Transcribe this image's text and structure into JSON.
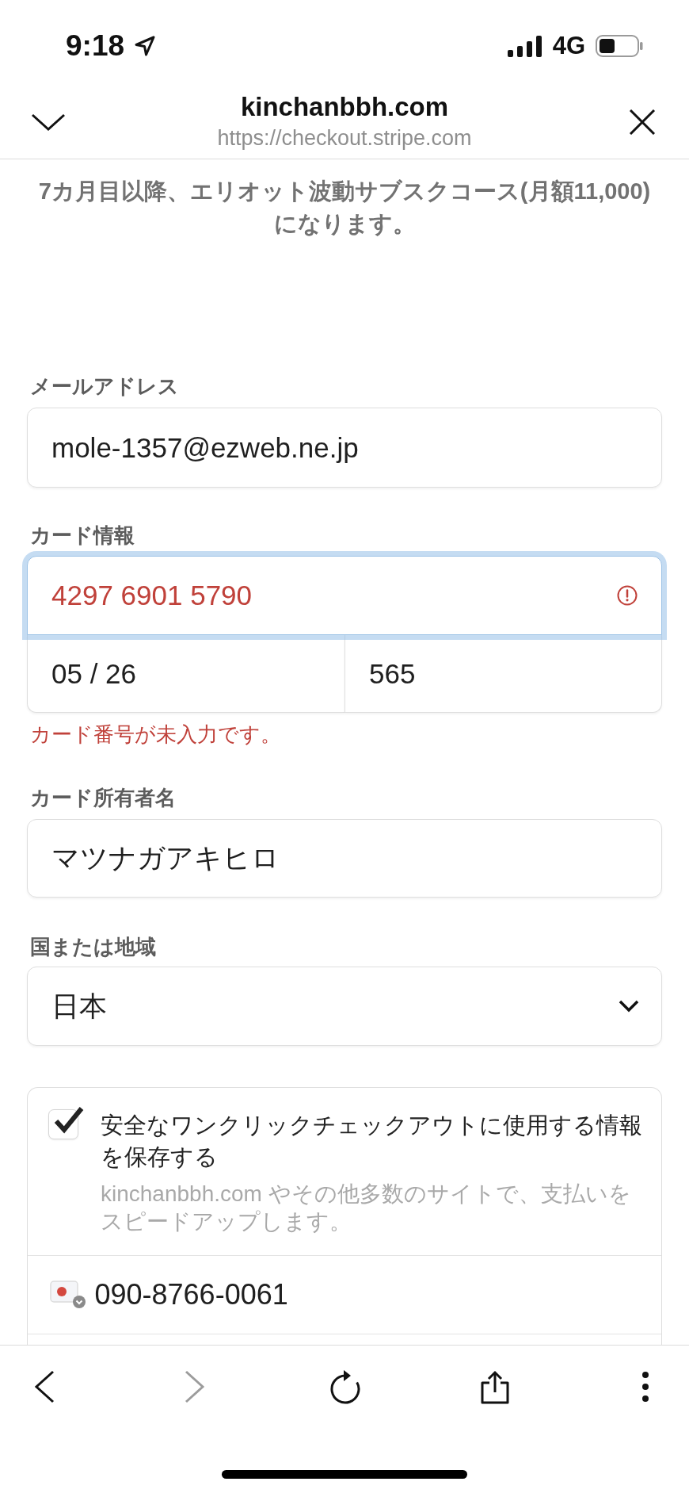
{
  "status_bar": {
    "time": "9:18",
    "network": "4G"
  },
  "browser_header": {
    "title": "kinchanbbh.com",
    "url": "https://checkout.stripe.com"
  },
  "notice": "7カ月目以降、エリオット波動サブスクコース(月額11,000)になります。",
  "email": {
    "label": "メールアドレス",
    "value": "mole-1357@ezweb.ne.jp"
  },
  "card": {
    "label": "カード情報",
    "number": "4297 6901 5790",
    "focused": true,
    "invalid": true,
    "expiry": "05 / 26",
    "cvc": "565",
    "error": "カード番号が未入力です。"
  },
  "cardholder": {
    "label": "カード所有者名",
    "value": "マツナガアキヒロ"
  },
  "country": {
    "label": "国または地域",
    "value": "日本"
  },
  "link_save": {
    "checked": true,
    "title": "安全なワンクリックチェックアウトに使用する情報を保存する",
    "description": "kinchanbbh.com やその他多数のサイトで、支払いをスピードアップします。",
    "phone": "090-8766-0061"
  },
  "toolbar": [
    {
      "kind": "back",
      "disabled": false
    },
    {
      "kind": "forward",
      "disabled": true
    },
    {
      "kind": "reload",
      "disabled": false
    },
    {
      "kind": "share",
      "disabled": false
    },
    {
      "kind": "more",
      "disabled": false
    }
  ]
}
